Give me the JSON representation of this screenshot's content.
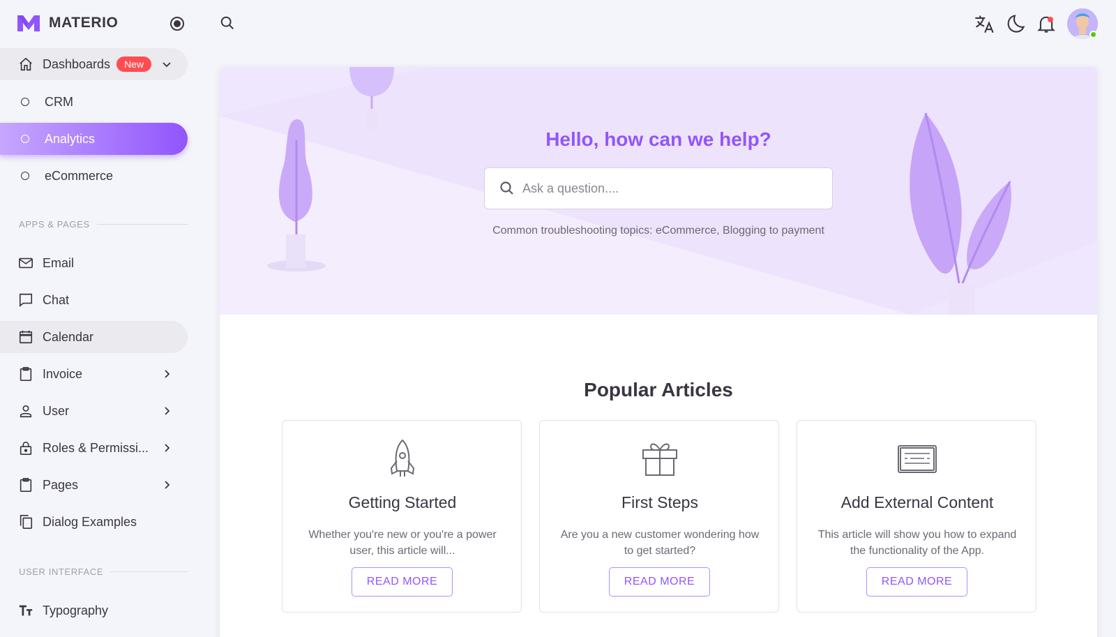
{
  "brand": {
    "name": "MATERIO",
    "color": "#9155fd"
  },
  "sidebar": {
    "dashboards": {
      "label": "Dashboards",
      "badge": "New"
    },
    "sub_items": [
      {
        "label": "CRM"
      },
      {
        "label": "Analytics"
      },
      {
        "label": "eCommerce"
      }
    ],
    "section_apps": "APPS & PAGES",
    "items": [
      {
        "label": "Email",
        "icon": "email-icon"
      },
      {
        "label": "Chat",
        "icon": "chat-icon"
      },
      {
        "label": "Calendar",
        "icon": "calendar-icon"
      },
      {
        "label": "Invoice",
        "icon": "invoice-icon"
      },
      {
        "label": "User",
        "icon": "user-icon"
      },
      {
        "label": "Roles & Permissi...",
        "icon": "lock-icon"
      },
      {
        "label": "Pages",
        "icon": "pages-icon"
      },
      {
        "label": "Dialog Examples",
        "icon": "copy-icon"
      }
    ],
    "section_ui": "USER INTERFACE",
    "typography": {
      "label": "Typography",
      "icon": "typography-icon"
    }
  },
  "hero": {
    "title": "Hello, how can we help?",
    "search_placeholder": "Ask a question....",
    "subtitle": "Common troubleshooting topics: eCommerce, Blogging to payment"
  },
  "popular": {
    "title": "Popular Articles",
    "articles": [
      {
        "title": "Getting Started",
        "desc": "Whether you're new or you're a power user, this article will...",
        "button": "READ MORE",
        "icon": "rocket-icon"
      },
      {
        "title": "First Steps",
        "desc": "Are you a new customer wondering how to get started?",
        "button": "READ MORE",
        "icon": "gift-icon"
      },
      {
        "title": "Add External Content",
        "desc": "This article will show you how to expand the functionality of the App.",
        "button": "READ MORE",
        "icon": "keyboard-icon"
      }
    ]
  },
  "colors": {
    "primary": "#9155fd",
    "badge": "#ff4c51",
    "online": "#56ca00",
    "hero_bg": "#efe7fd"
  }
}
